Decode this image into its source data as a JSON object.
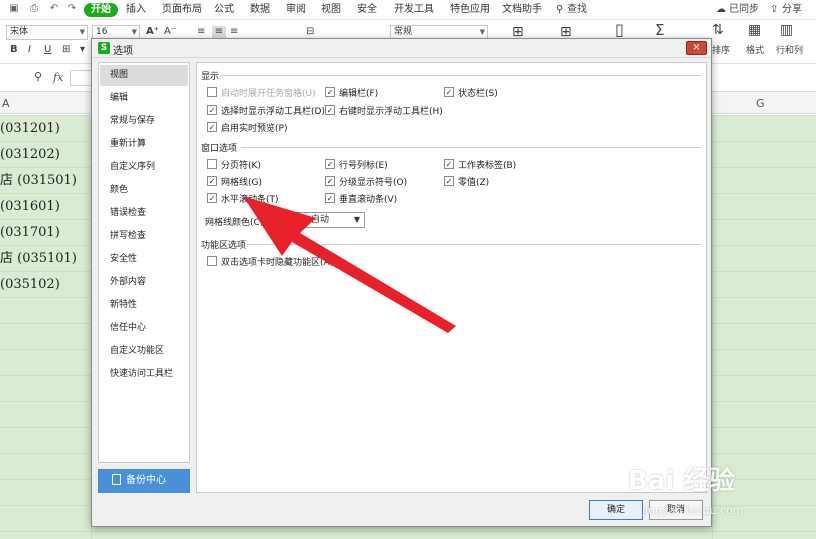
{
  "app": {
    "menu_tabs": [
      "开始",
      "插入",
      "页面布局",
      "公式",
      "数据",
      "审阅",
      "视图",
      "安全",
      "开发工具",
      "特色应用",
      "文档助手"
    ],
    "search_label": "查找",
    "sync_label": "已同步",
    "share_label": "分享"
  },
  "toolbar": {
    "font_name": "宋体",
    "font_size": "16",
    "number_format": "常规",
    "sort_label": "排序",
    "format_label": "格式",
    "rowcol_label": "行和列"
  },
  "formula": {
    "fx_label": "fx"
  },
  "sheet": {
    "col_a": "A",
    "col_g": "G",
    "cells": [
      "(031201)",
      "(031202)",
      "店 (031501)",
      "(031601)",
      "(031701)",
      "店 (035101)",
      "(035102)"
    ]
  },
  "dialog": {
    "title": "选项",
    "close_glyph": "×",
    "nav_items": [
      "视图",
      "编辑",
      "常规与保存",
      "重新计算",
      "自定义序列",
      "颜色",
      "错误检查",
      "拼写检查",
      "安全性",
      "外部内容",
      "新特性",
      "信任中心",
      "自定义功能区",
      "快速访问工具栏"
    ],
    "backup_label": "备份中心",
    "sections": {
      "display": "显示",
      "window": "窗口选项",
      "ribbon": "功能区选项"
    },
    "display_opts": [
      {
        "label": "启动时展开任务窗格(U)",
        "checked": false,
        "disabled": true
      },
      {
        "label": "编辑栏(F)",
        "checked": true,
        "disabled": false
      },
      {
        "label": "状态栏(S)",
        "checked": true,
        "disabled": false
      },
      {
        "label": "选择时显示浮动工具栏(D)",
        "checked": true,
        "disabled": false
      },
      {
        "label": "右键时显示浮动工具栏(H)",
        "checked": true,
        "disabled": false
      },
      {
        "label": "启用实时预览(P)",
        "checked": true,
        "disabled": false
      }
    ],
    "window_opts": [
      {
        "label": "分页符(K)",
        "checked": false
      },
      {
        "label": "行号列标(E)",
        "checked": true
      },
      {
        "label": "工作表标签(B)",
        "checked": true
      },
      {
        "label": "网格线(G)",
        "checked": true
      },
      {
        "label": "分级显示符号(O)",
        "checked": true
      },
      {
        "label": "零值(Z)",
        "checked": true
      },
      {
        "label": "水平滚动条(T)",
        "checked": true
      },
      {
        "label": "垂直滚动条(V)",
        "checked": true
      }
    ],
    "grid_color_label": "网格线颜色(C):",
    "grid_color_value": "自动",
    "ribbon_opts": [
      {
        "label": "双击选项卡时隐藏功能区(A)",
        "checked": false
      }
    ],
    "ok_label": "确定",
    "cancel_label": "取消"
  },
  "watermark": {
    "line1": "Bai 经验",
    "line2": "jingyan.baidu.com"
  },
  "colors": {
    "accent_green": "#1aad19",
    "sheet_green": "#d9ecd3",
    "arrow_red": "#e8202a",
    "backup_blue": "#4a90d9"
  }
}
